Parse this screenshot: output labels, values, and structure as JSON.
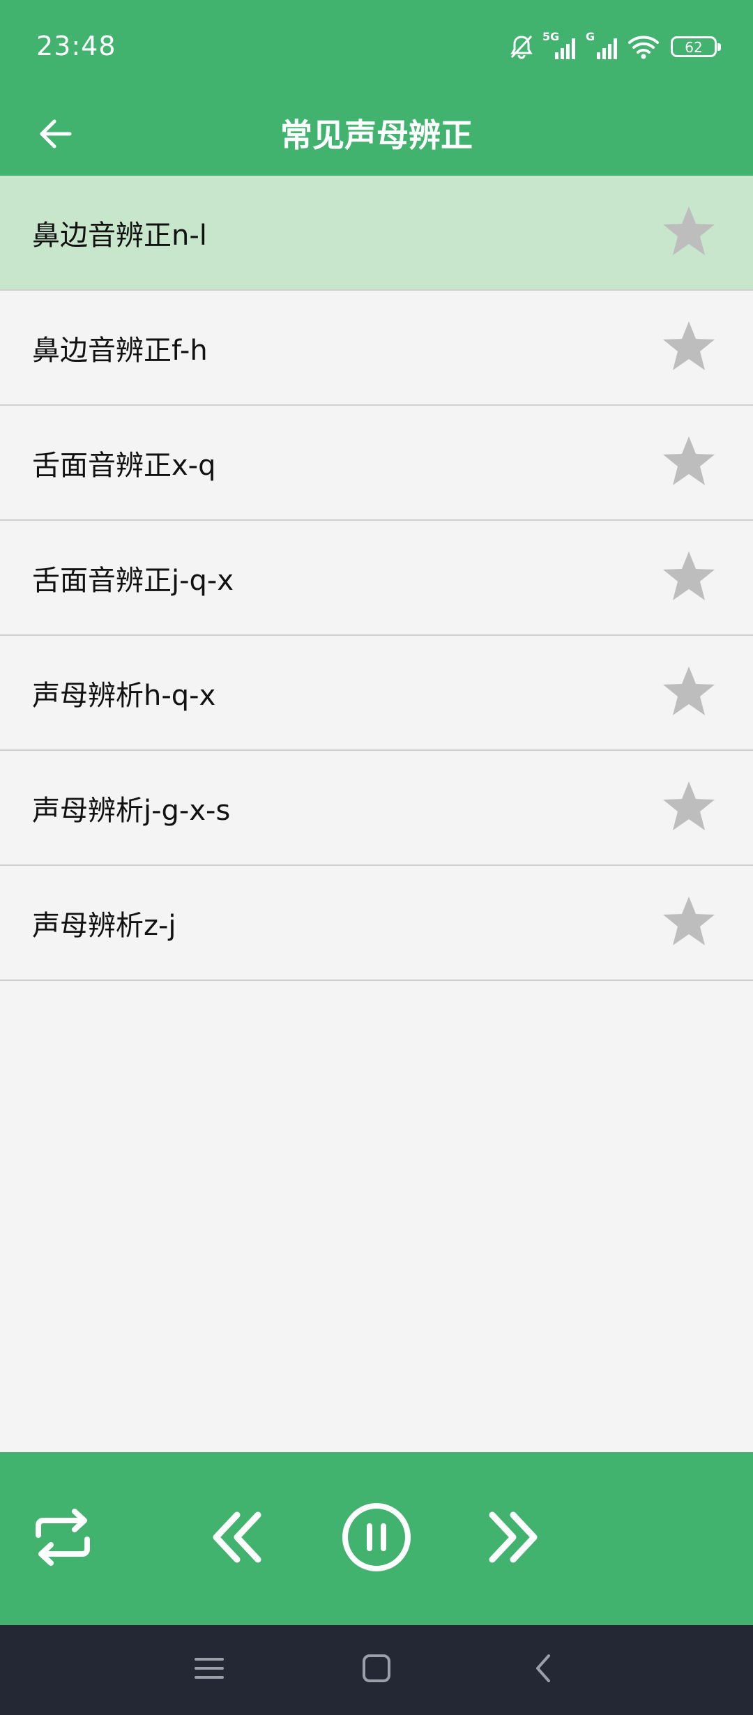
{
  "status_bar": {
    "time": "23:48",
    "network_5g": "5G",
    "network_g": "G",
    "battery": "62"
  },
  "header": {
    "title": "常见声母辨正"
  },
  "list": {
    "items": [
      {
        "label": "鼻边音辨正n-l",
        "selected": true
      },
      {
        "label": "鼻边音辨正f-h",
        "selected": false
      },
      {
        "label": "舌面音辨正x-q",
        "selected": false
      },
      {
        "label": "舌面音辨正j-q-x",
        "selected": false
      },
      {
        "label": "声母辨析h-q-x",
        "selected": false
      },
      {
        "label": "声母辨析j-g-x-s",
        "selected": false
      },
      {
        "label": "声母辨析z-j",
        "selected": false
      }
    ]
  },
  "player": {
    "controls": [
      "repeat-icon",
      "previous-icon",
      "pause-icon",
      "next-icon"
    ]
  },
  "navigation": {
    "controls": [
      "menu-icon",
      "home-icon",
      "back-icon"
    ]
  },
  "colors": {
    "primary": "#41b36f",
    "selected_row": "#c7e6cb",
    "background": "#f4f4f4",
    "star": "#bdbdbd",
    "nav_bar": "#232834"
  }
}
